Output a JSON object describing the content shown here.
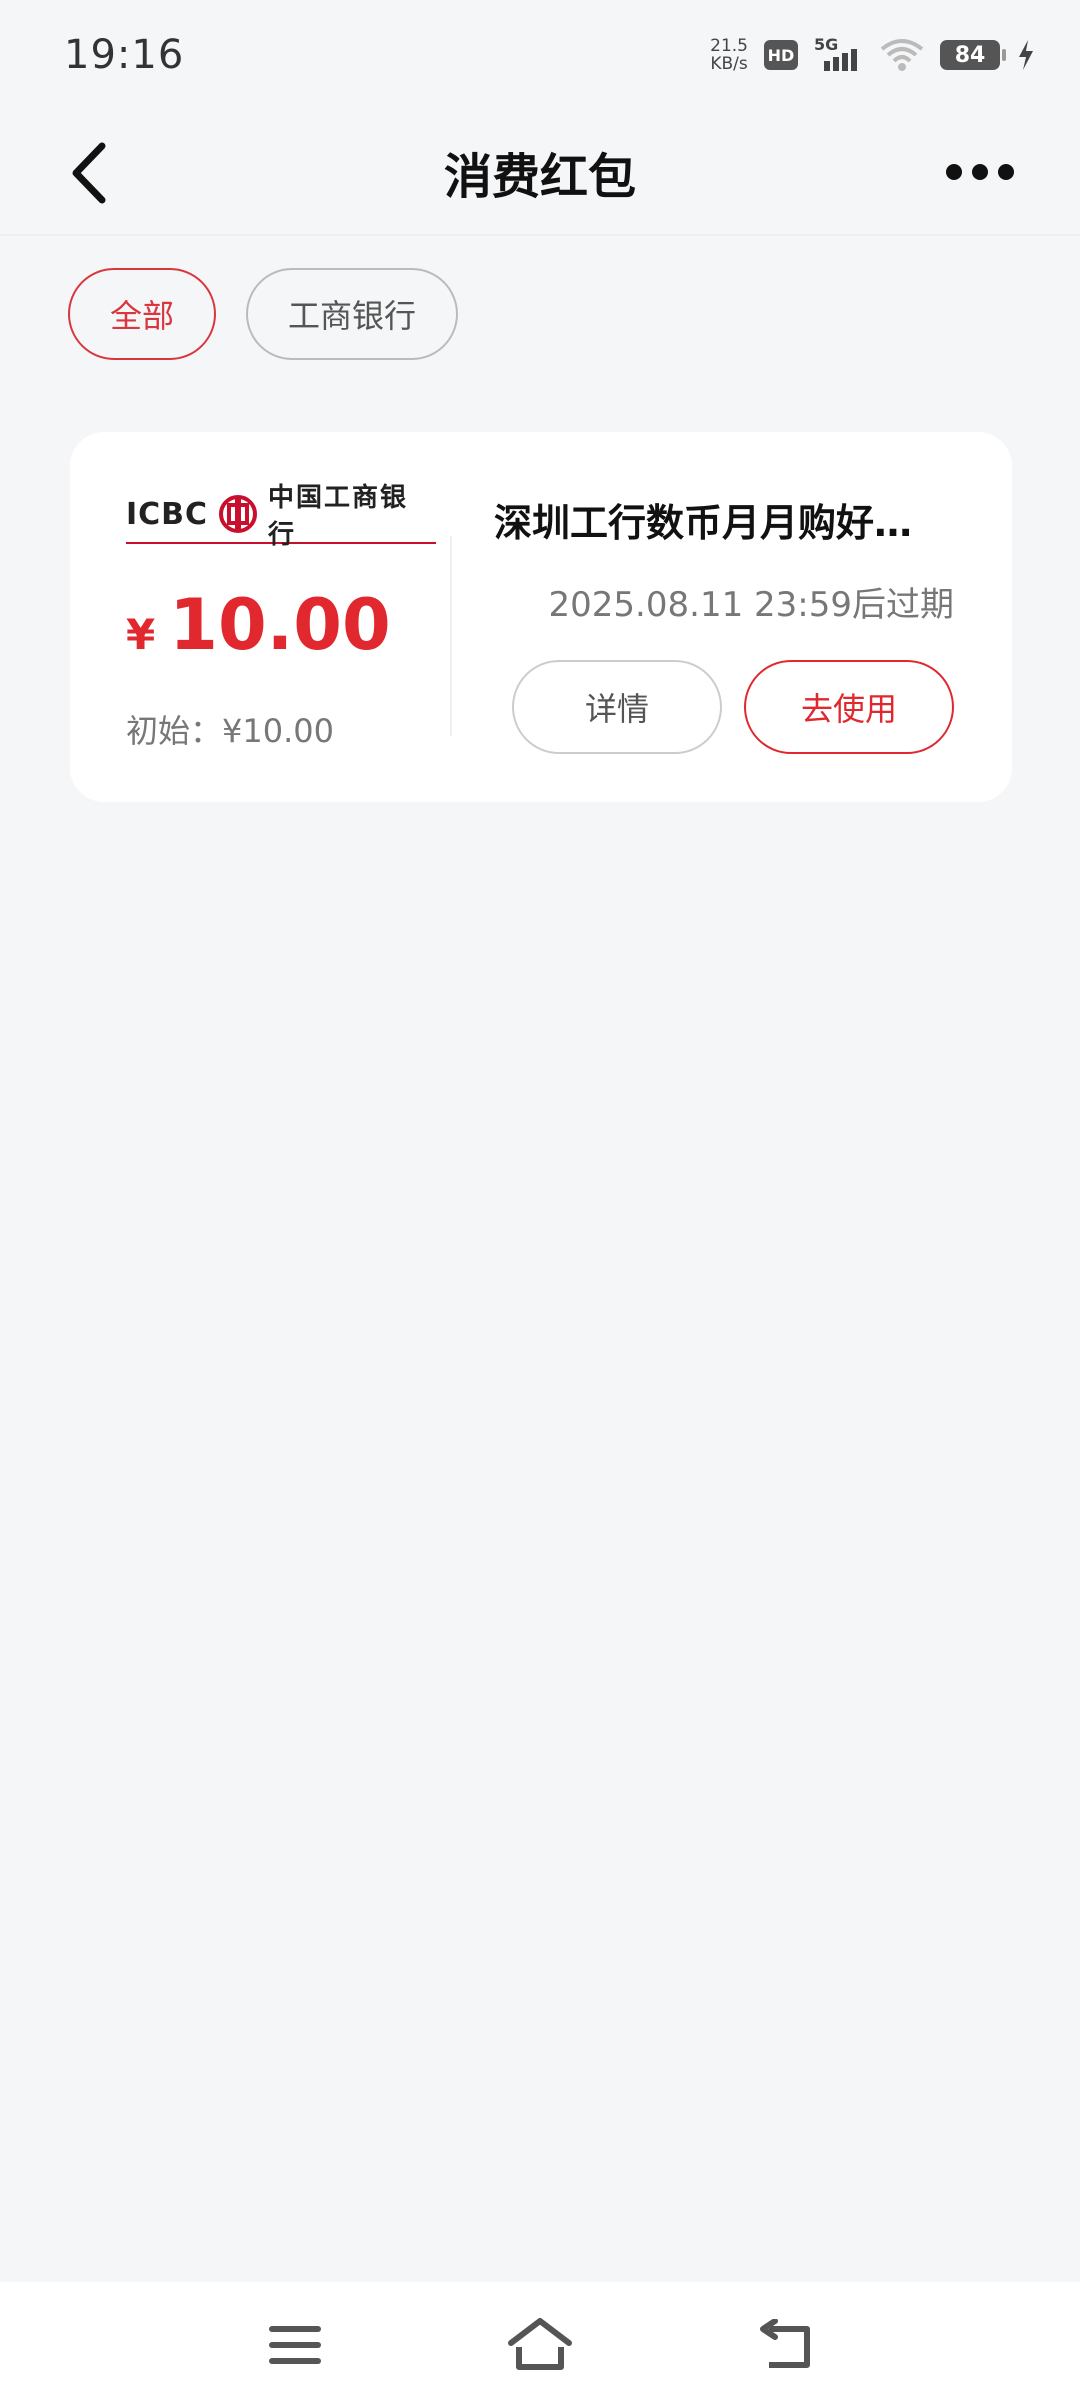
{
  "status_bar": {
    "time": "19:16",
    "net_speed_value": "21.5",
    "net_speed_unit": "KB/s",
    "hd_label": "HD",
    "network_label": "5G",
    "battery_level": "84"
  },
  "header": {
    "title": "消费红包"
  },
  "filters": [
    {
      "label": "全部",
      "active": true
    },
    {
      "label": "工商银行",
      "active": false
    }
  ],
  "coupon": {
    "bank_logo_text": "ICBC",
    "bank_name": "中国工商银行",
    "currency_symbol": "¥",
    "amount": "10.00",
    "initial_label": "初始：¥10.00",
    "title": "深圳工行数币月月购好…",
    "expiry": "2025.08.11 23:59后过期",
    "detail_label": "详情",
    "use_label": "去使用"
  },
  "colors": {
    "accent": "#e0282e",
    "background": "#f5f6f8",
    "card": "#ffffff"
  }
}
